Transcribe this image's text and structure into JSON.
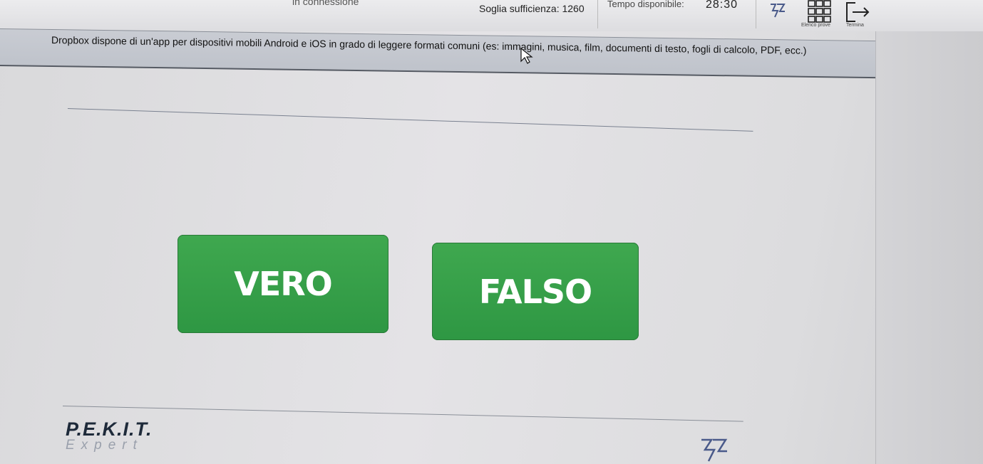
{
  "topbar": {
    "connection_text": "in connessione",
    "threshold_text": "Soglia sufficienza: 1260",
    "time_label": "Tempo disponibile:",
    "time_value": "28:30",
    "test_list_label": "Elenco prove",
    "finish_label": "Termina"
  },
  "question": {
    "text": "Dropbox dispone di un'app per dispositivi mobili Android e iOS in grado di leggere formati comuni (es: immagini, musica, film, documenti di testo, fogli di calcolo, PDF, ecc.)"
  },
  "answers": {
    "true_label": "VERO",
    "false_label": "FALSO"
  },
  "brand": {
    "name": "P.E.K.I.T.",
    "subtitle": "Expert"
  },
  "colors": {
    "button_green": "#2e9743",
    "question_bar": "#c4c8cf",
    "brand_dark": "#1e2a3a"
  }
}
